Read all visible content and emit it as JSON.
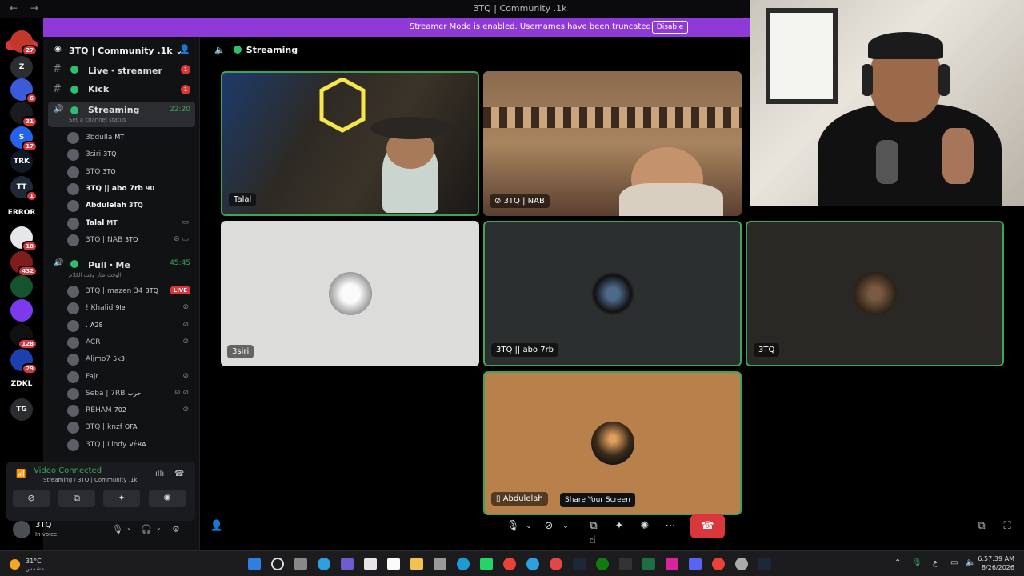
{
  "window": {
    "title": "3TQ | Community .1k",
    "nav_arrows": "← →"
  },
  "streamer_bar": {
    "message": "Streamer Mode is enabled. Usernames have been truncated.",
    "button": "Disable"
  },
  "rail": {
    "new_label": "NEW",
    "servers": [
      {
        "label": "",
        "badge": "27",
        "color": "#c0392b"
      },
      {
        "label": "Z",
        "badge": "",
        "color": "#2b2d31"
      },
      {
        "label": "",
        "badge": "6",
        "color": "#3b5bdb"
      },
      {
        "label": "",
        "badge": "31",
        "color": "#1a1b1e"
      },
      {
        "label": "S",
        "badge": "17",
        "color": "#2563eb"
      },
      {
        "label": "TRK",
        "badge": "",
        "color": "#111827"
      },
      {
        "label": "TT",
        "badge": "1",
        "color": "#1f2937"
      },
      {
        "label": "ERROR",
        "badge": "",
        "color": "#000"
      },
      {
        "label": "",
        "badge": "18",
        "color": "#e5e7eb"
      },
      {
        "label": "",
        "badge": "432",
        "color": "#7f1d1d"
      },
      {
        "label": "",
        "badge": "",
        "color": "#14532d"
      },
      {
        "label": "",
        "badge": "",
        "color": "#7c3aed"
      },
      {
        "label": "",
        "badge": "128",
        "color": "#111"
      },
      {
        "label": "",
        "badge": "29",
        "color": "#1e40af"
      },
      {
        "label": "ZDKL",
        "badge": "",
        "color": "#000"
      },
      {
        "label": "TG",
        "badge": "",
        "color": "#2b2d31"
      }
    ]
  },
  "sidebar": {
    "server_name": "3TQ | Community .1k",
    "channels": [
      {
        "label": "Live・streamer",
        "count": "1"
      },
      {
        "label": "Kick",
        "count": "1"
      }
    ],
    "active_channel": {
      "label": "Streaming",
      "time": "22:20",
      "status": "Set a channel status"
    },
    "members": [
      {
        "name": "3bdulla",
        "tag": "MT",
        "icon": "",
        "bold": false
      },
      {
        "name": "3siri",
        "tag": "3TQ",
        "icon": "",
        "bold": false
      },
      {
        "name": "3TQ",
        "tag": "3TQ",
        "icon": "",
        "bold": false
      },
      {
        "name": "3TQ || abo 7rb",
        "tag": "90",
        "icon": "",
        "bold": true
      },
      {
        "name": "Abdulelah",
        "tag": "3TQ",
        "icon": "",
        "bold": true
      },
      {
        "name": "Talal",
        "tag": "MT",
        "icon": "▭",
        "bold": true
      },
      {
        "name": "3TQ | NAB",
        "tag": "3TQ",
        "icon": "⊘ ▭",
        "bold": false
      }
    ],
    "channel2": {
      "label": "Pull・Me",
      "time": "45:45",
      "status": "الوقت طار وقت الكلام"
    },
    "members2": [
      {
        "name": "3TQ | mazen 34",
        "tag": "3TQ",
        "icon": "",
        "live": "LIVE"
      },
      {
        "name": "! Khalid",
        "tag": "9le",
        "icon": "⊘",
        "live": ""
      },
      {
        "name": ".",
        "tag": "A28",
        "icon": "⊘",
        "live": ""
      },
      {
        "name": "ACR",
        "tag": "",
        "icon": "⊘",
        "live": ""
      },
      {
        "name": "Aljmo7",
        "tag": "5k3",
        "icon": "",
        "live": ""
      },
      {
        "name": "Fajr",
        "tag": "",
        "icon": "⊘",
        "live": ""
      },
      {
        "name": "Seba | 7RB",
        "tag": "حرب",
        "icon": "⊘ ⊘",
        "live": ""
      },
      {
        "name": "REHAM",
        "tag": "702",
        "icon": "⊘",
        "live": ""
      },
      {
        "name": "3TQ | knzf",
        "tag": "OFA",
        "icon": "",
        "live": ""
      },
      {
        "name": "3TQ | Lindy",
        "tag": "VÉRA",
        "icon": "",
        "live": ""
      }
    ],
    "voice": {
      "connected": "Video Connected",
      "channel": "Streaming / 3TQ | Community .1k"
    },
    "user": {
      "name": "3TQ",
      "status": "In voice"
    }
  },
  "main": {
    "channel_title": "Streaming",
    "tiles": [
      {
        "name": "Talal"
      },
      {
        "name": "3TQ | NAB"
      },
      {
        "name": "3siri"
      },
      {
        "name": "3TQ || abo 7rb"
      },
      {
        "name": "3TQ"
      },
      {
        "name": "Abdulelah"
      }
    ],
    "tooltip": "Share Your Screen"
  },
  "taskbar": {
    "weather_temp": "31°C",
    "weather_desc": "مشمس",
    "time": "6:57:39 AM",
    "date": "8/26/2026",
    "lang": "ع"
  }
}
